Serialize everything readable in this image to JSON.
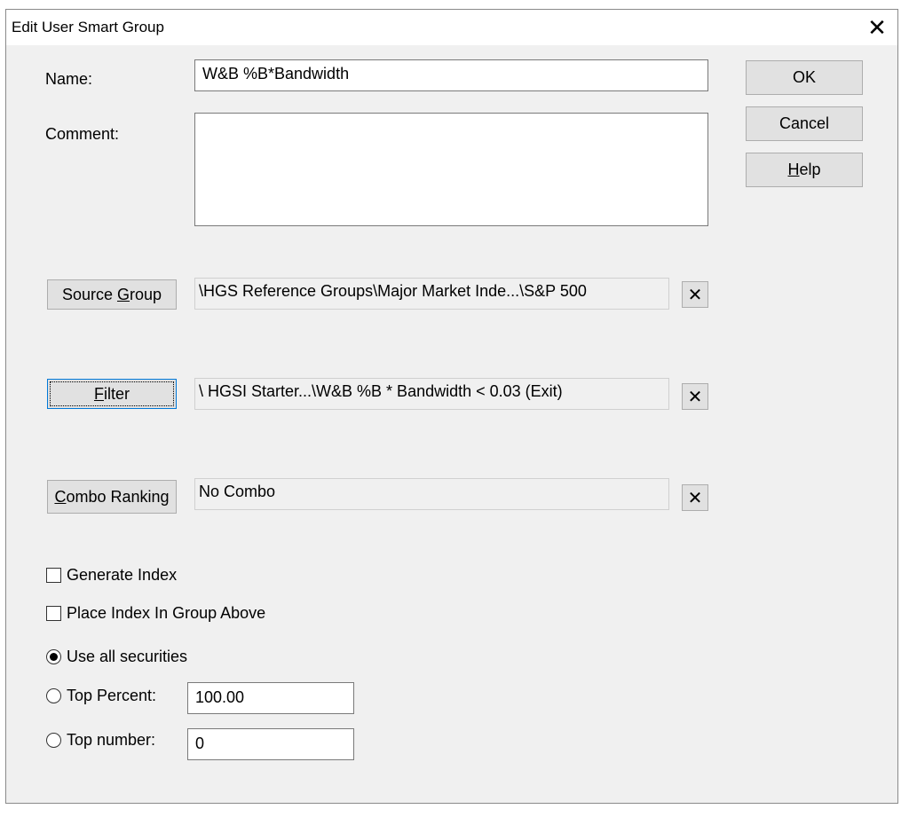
{
  "window": {
    "title": "Edit User Smart Group",
    "close_glyph": "✕"
  },
  "fields": {
    "name_label": "Name:",
    "name_value": "W&B %B*Bandwidth",
    "comment_label": "Comment:",
    "comment_value": ""
  },
  "buttons": {
    "ok": "OK",
    "cancel": "Cancel",
    "help_hotkey": "H",
    "help_rest": "elp"
  },
  "source_group": {
    "btn_pre": "Source ",
    "btn_hotkey": "G",
    "btn_post": "roup",
    "value": "\\HGS Reference Groups\\Major Market Inde...\\S&P 500"
  },
  "filter": {
    "btn_hotkey": "F",
    "btn_post": "ilter",
    "value": "\\ HGSI Starter...\\W&B %B * Bandwidth < 0.03 (Exit)"
  },
  "combo": {
    "btn_hotkey": "C",
    "btn_post": "ombo Ranking",
    "value": "No Combo"
  },
  "clear_glyph": "✕",
  "options": {
    "generate_index": {
      "label": "Generate Index",
      "checked": false
    },
    "place_index": {
      "label": "Place Index In Group Above",
      "checked": false
    },
    "use_all": {
      "label": "Use all securities",
      "selected": true
    },
    "top_percent": {
      "label": "Top Percent:",
      "value": "100.00",
      "selected": false
    },
    "top_number": {
      "label": "Top number:",
      "value": "0",
      "selected": false
    }
  }
}
